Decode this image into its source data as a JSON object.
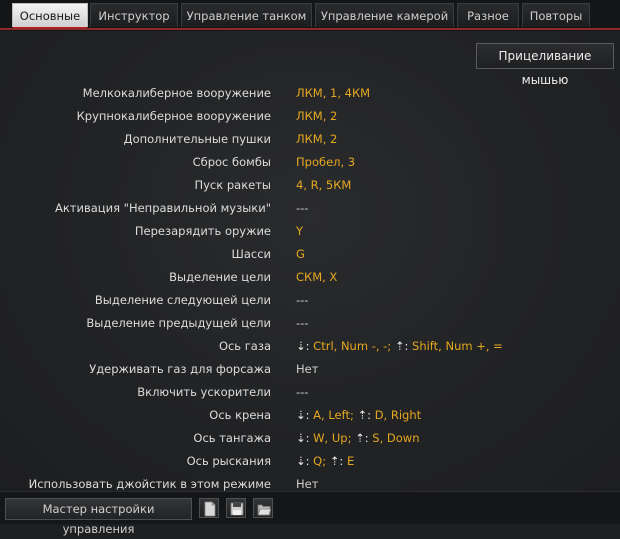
{
  "tabs": [
    {
      "label": "Основные",
      "active": true
    },
    {
      "label": "Инструктор",
      "active": false
    },
    {
      "label": "Управление танком",
      "active": false
    },
    {
      "label": "Управление камерой",
      "active": false
    },
    {
      "label": "Разное",
      "active": false
    },
    {
      "label": "Повторы",
      "active": false
    }
  ],
  "mouse_aim_button": "Прицеливание мышью",
  "bindings": [
    {
      "label": "Мелкокалиберное вооружение",
      "value": "ЛКМ, 1, 4КМ"
    },
    {
      "label": "Крупнокалиберное вооружение",
      "value": "ЛКМ, 2"
    },
    {
      "label": "Дополнительные пушки",
      "value": "ЛКМ, 2"
    },
    {
      "label": "Сброс бомбы",
      "value": "Пробел, 3"
    },
    {
      "label": "Пуск ракеты",
      "value": "4, R, 5КМ"
    },
    {
      "label": "Активация \"Неправильной музыки\"",
      "value": "---"
    },
    {
      "label": "Перезарядить оружие",
      "value": "Y"
    },
    {
      "label": "Шасси",
      "value": "G"
    },
    {
      "label": "Выделение цели",
      "value": "СКМ, X"
    },
    {
      "label": "Выделение следующей цели",
      "value": "---"
    },
    {
      "label": "Выделение предыдущей цели",
      "value": "---"
    },
    {
      "label": "Ось газа",
      "axis": {
        "down_icon": "⇣:",
        "down": "Ctrl, Num -, -;",
        "up_icon": "⇡:",
        "up": "Shift, Num +, ="
      }
    },
    {
      "label": "Удерживать газ для форсажа",
      "value": "Нет"
    },
    {
      "label": "Включить ускорители",
      "value": "---"
    },
    {
      "label": "Ось крена",
      "axis": {
        "down_icon": "⇣:",
        "down": "A, Left;",
        "up_icon": "⇡:",
        "up": "D, Right"
      }
    },
    {
      "label": "Ось тангажа",
      "axis": {
        "down_icon": "⇣:",
        "down": "W, Up;",
        "up_icon": "⇡:",
        "up": "S, Down"
      }
    },
    {
      "label": "Ось рыскания",
      "axis": {
        "down_icon": "⇣:",
        "down": "Q;",
        "up_icon": "⇡:",
        "up": "E"
      }
    },
    {
      "label": "Использовать джойстик в этом режиме",
      "value": "Нет"
    }
  ],
  "bottom": {
    "wizard_label": "Мастер настройки управления",
    "icons": [
      "new-file-icon",
      "save-icon",
      "open-folder-icon"
    ]
  },
  "colors": {
    "accent": "#c01c1c",
    "value": "#e6a820",
    "text": "#dcdcdc"
  }
}
